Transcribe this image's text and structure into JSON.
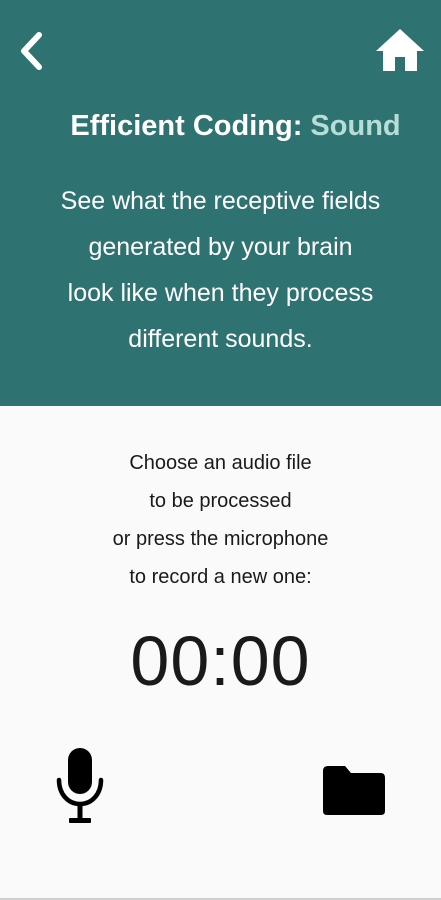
{
  "header": {
    "title_main": "Efficient Coding:",
    "title_accent": "Sound",
    "description_lines": [
      "See what the receptive fields",
      "generated by your brain",
      "look like when they process",
      "different sounds."
    ],
    "background_color": "#2f7272",
    "accent_color": "#b6ddd6",
    "back_icon": "chevron-left-icon",
    "home_icon": "home-icon"
  },
  "main": {
    "instruction_lines": [
      "Choose an audio file",
      "to be processed",
      "or press the microphone",
      "to record a new one:"
    ],
    "timer": "00:00",
    "mic_icon": "microphone-icon",
    "folder_icon": "folder-icon"
  }
}
